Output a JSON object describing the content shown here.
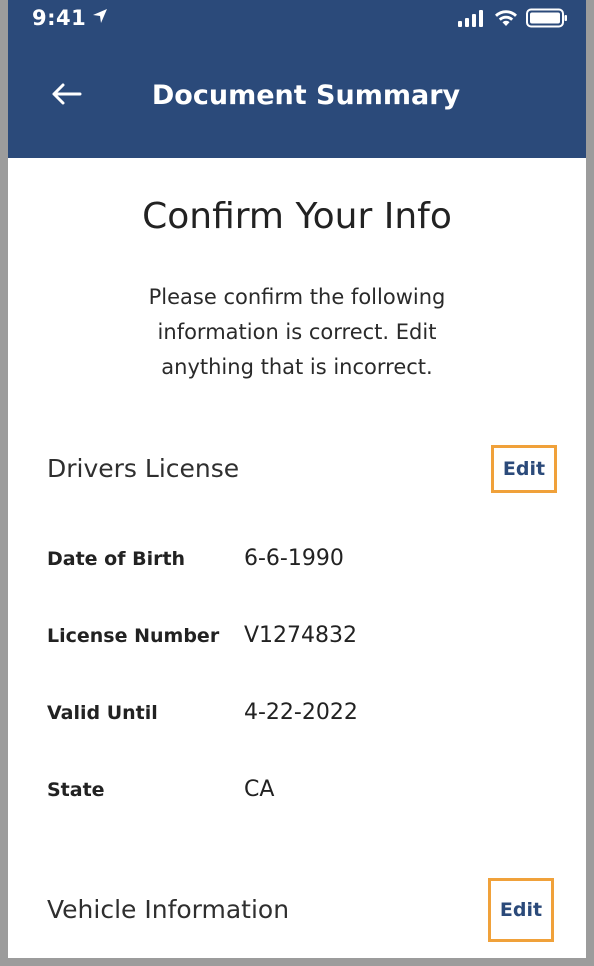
{
  "status_bar": {
    "time": "9:41"
  },
  "header": {
    "title": "Document Summary"
  },
  "page": {
    "title": "Confirm Your Info",
    "intro": "Please confirm the following information is correct. Edit anything that is incorrect."
  },
  "sections": {
    "drivers_license": {
      "title": "Drivers License",
      "edit_label": "Edit",
      "fields": [
        {
          "label": "Date of Birth",
          "value": "6-6-1990"
        },
        {
          "label": "License Number",
          "value": "V1274832"
        },
        {
          "label": "Valid Until",
          "value": "4-22-2022"
        },
        {
          "label": "State",
          "value": "CA"
        }
      ]
    },
    "vehicle_information": {
      "title": "Vehicle Information",
      "edit_label": "Edit"
    }
  },
  "colors": {
    "header_bg": "#2b4a7a",
    "accent_border": "#f0a13a",
    "link_text": "#2b4a7a"
  },
  "icons": {
    "back": "arrow-left-icon",
    "location": "location-arrow-icon",
    "signal": "cellular-signal-icon",
    "wifi": "wifi-icon",
    "battery": "battery-icon"
  }
}
